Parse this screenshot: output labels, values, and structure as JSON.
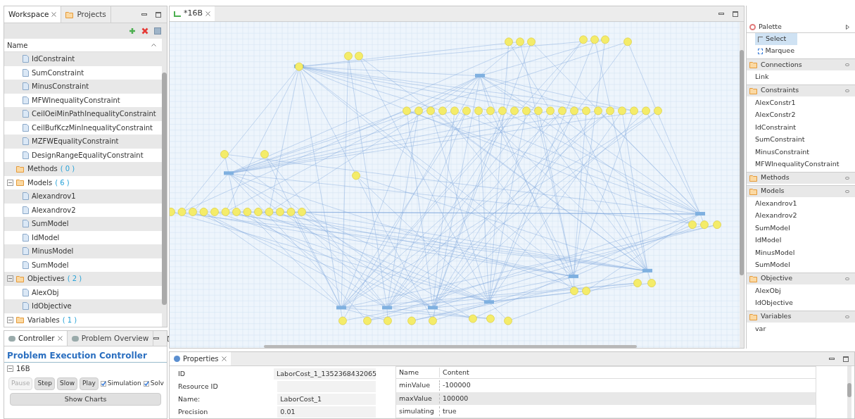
{
  "workspace": {
    "tabs": [
      {
        "label": "Workspace",
        "selected": true,
        "closable": true
      },
      {
        "label": "Projects",
        "selected": false,
        "closable": false
      }
    ],
    "column": "Name",
    "tree": [
      {
        "kind": "group",
        "children": [
          {
            "kind": "file",
            "label": "IdConstraint"
          },
          {
            "kind": "file",
            "label": "SumConstraint"
          },
          {
            "kind": "file",
            "label": "MinusConstraint"
          },
          {
            "kind": "file",
            "label": "MFWInequalityConstraint"
          },
          {
            "kind": "file",
            "label": "CeilOeiMinPathInequalityConstraint"
          },
          {
            "kind": "file",
            "label": "CeilBufKczMinInequalityConstraint"
          },
          {
            "kind": "file",
            "label": "MZFWEqualityConstraint"
          },
          {
            "kind": "file",
            "label": "DesignRangeEqualityConstraint"
          }
        ]
      },
      {
        "kind": "folder",
        "label": "Methods",
        "count": "( 0 )"
      },
      {
        "kind": "folder",
        "label": "Models",
        "count": "( 6 )",
        "expanded": true,
        "children": [
          {
            "kind": "file",
            "label": "Alexandrov1"
          },
          {
            "kind": "file",
            "label": "Alexandrov2"
          },
          {
            "kind": "file",
            "label": "SumModel"
          },
          {
            "kind": "file",
            "label": "IdModel"
          },
          {
            "kind": "file",
            "label": "MinusModel"
          },
          {
            "kind": "file",
            "label": "SumModel"
          }
        ]
      },
      {
        "kind": "folder",
        "label": "Objectives",
        "count": "( 2 )",
        "expanded": true,
        "children": [
          {
            "kind": "file",
            "label": "AlexObj"
          },
          {
            "kind": "file",
            "label": "IdObjective"
          }
        ]
      },
      {
        "kind": "folder",
        "label": "Variables",
        "count": "( 1 )",
        "expanded": true
      }
    ]
  },
  "controller": {
    "tabs": [
      {
        "label": "Controller",
        "selected": true,
        "closable": true
      },
      {
        "label": "Problem Overview",
        "selected": false,
        "closable": false
      }
    ],
    "title": "Problem Execution Controller",
    "problem": "16B",
    "problem_expanded": true,
    "buttons": [
      {
        "label": "Pause",
        "disabled": true
      },
      {
        "label": "Step",
        "disabled": false
      },
      {
        "label": "Slow",
        "disabled": false
      },
      {
        "label": "Play",
        "disabled": false
      }
    ],
    "checkboxes": [
      {
        "label": "Simulation",
        "checked": true
      },
      {
        "label": "Solv",
        "checked": true
      }
    ],
    "charts_button": "Show Charts"
  },
  "editor": {
    "tabs": [
      {
        "label": "*16B",
        "selected": true
      }
    ]
  },
  "palette": {
    "title": "Palette",
    "tools": [
      {
        "label": "Select",
        "selected": true
      },
      {
        "label": "Marquee",
        "selected": false
      }
    ],
    "drawers": [
      {
        "label": "Connections",
        "items": [
          "Link"
        ]
      },
      {
        "label": "Constraints",
        "items": [
          "AlexConstr1",
          "AlexConstr2",
          "IdConstraint",
          "SumConstraint",
          "MinusConstraint",
          "MFWInequalityConstraint"
        ]
      },
      {
        "label": "Methods"
      },
      {
        "label": "Models",
        "items": [
          "Alexandrov1",
          "Alexandrov2",
          "SumModel",
          "IdModel",
          "MinusModel",
          "SumModel"
        ]
      },
      {
        "label": "Objective",
        "items": [
          "AlexObj",
          "IdObjective"
        ]
      },
      {
        "label": "Variables",
        "items": [
          "var"
        ]
      }
    ]
  },
  "properties": {
    "tab": "Properties",
    "fields": [
      {
        "label": "ID",
        "value": "LaborCost_1_1352368432065"
      },
      {
        "label": "Resource ID"
      },
      {
        "label": "Name:",
        "value": "LaborCost_1"
      },
      {
        "label": "Precision",
        "value": "0.01"
      }
    ],
    "table": {
      "columns": [
        "Name",
        "Content"
      ],
      "rows": [
        [
          "minValue",
          "-100000"
        ],
        [
          "maxValue",
          "100000"
        ],
        [
          "simulating",
          "true"
        ]
      ]
    }
  }
}
